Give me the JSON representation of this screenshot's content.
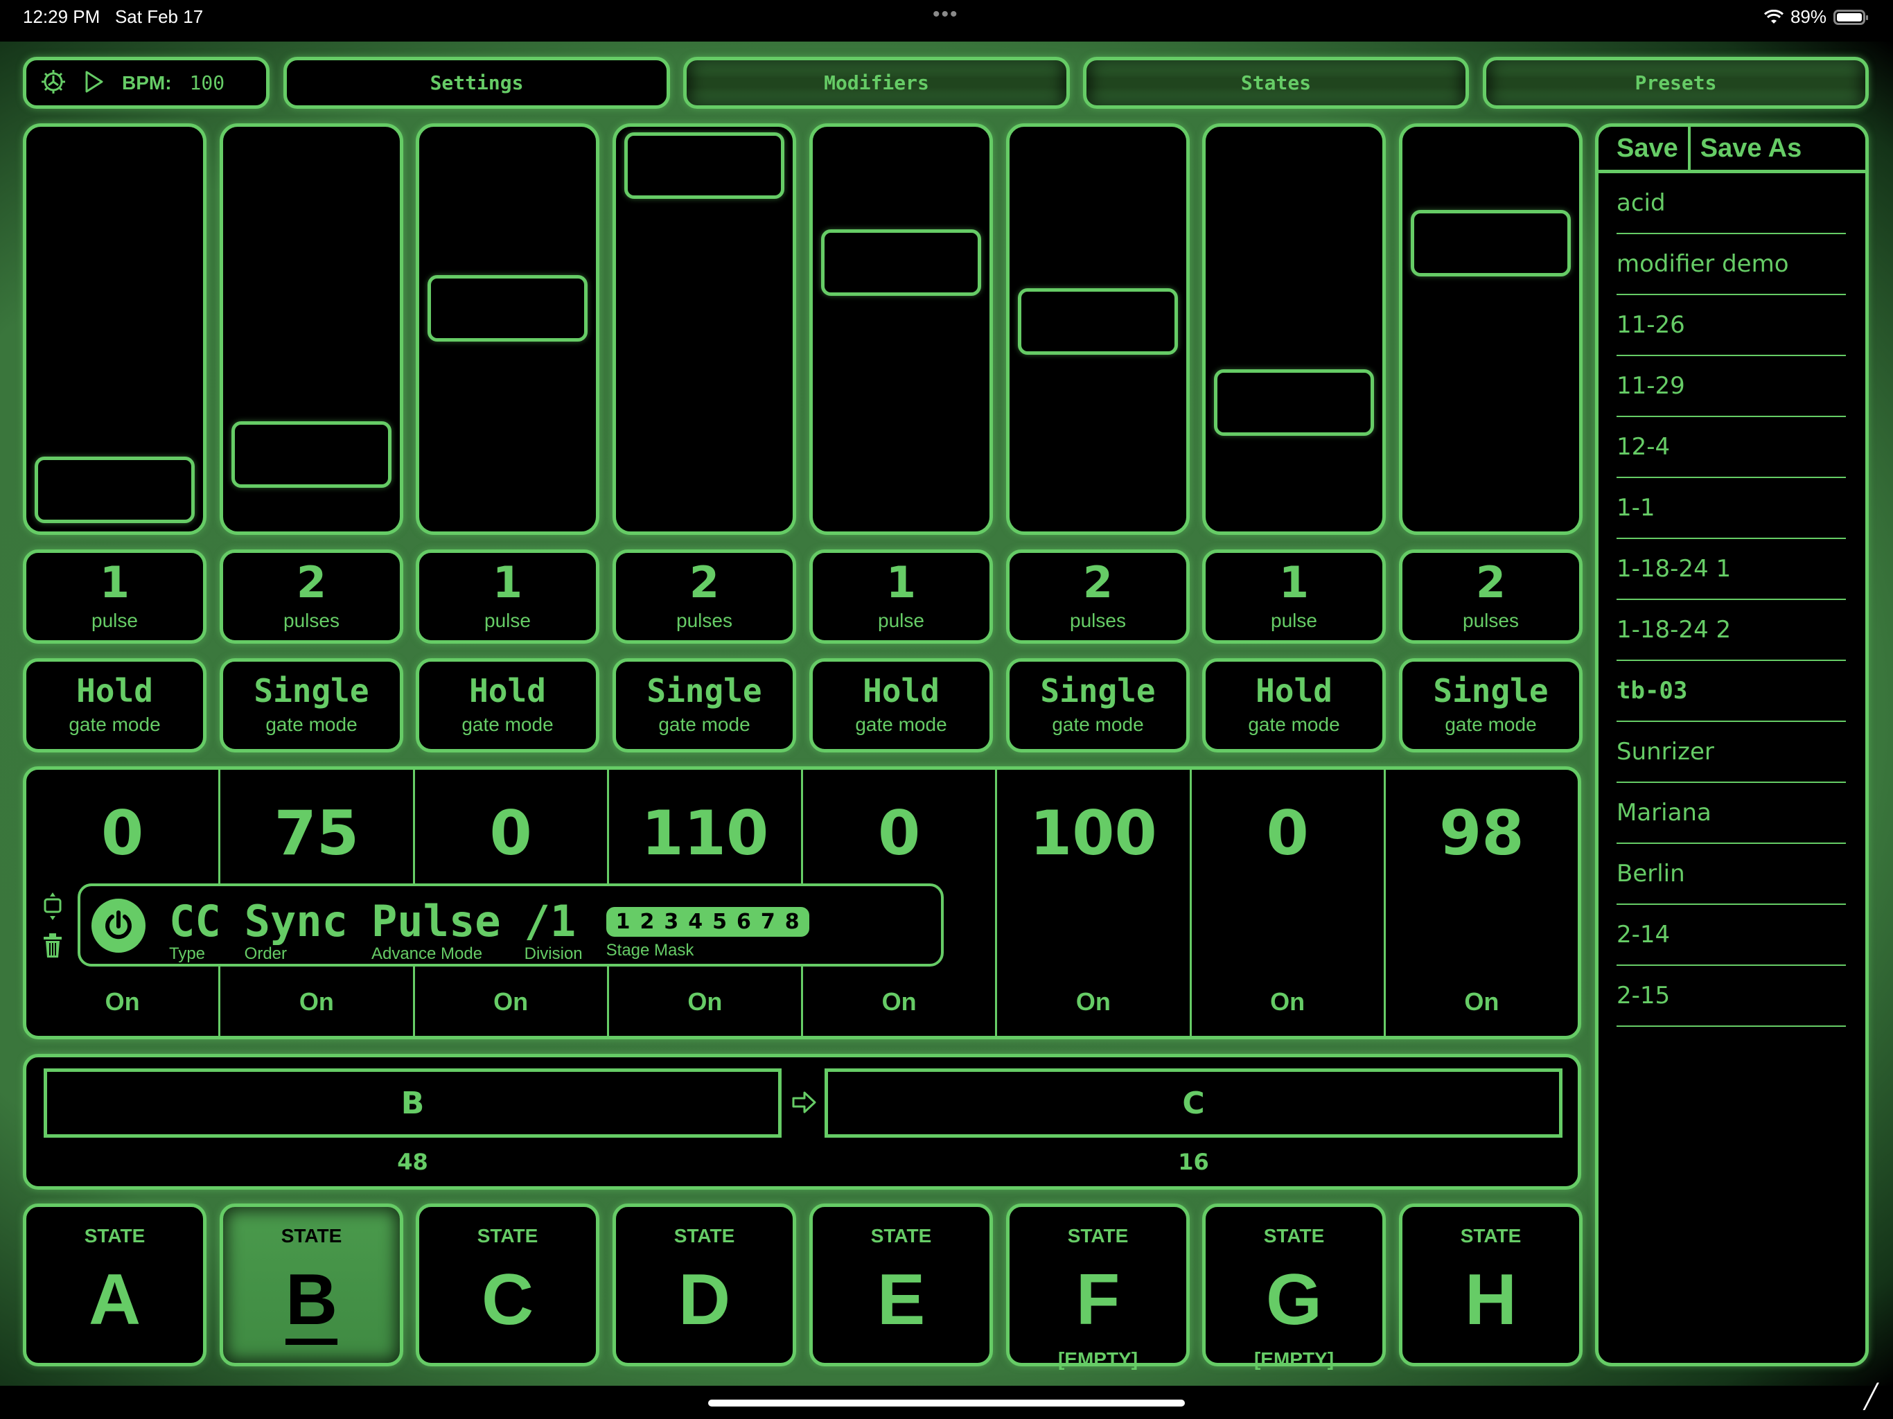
{
  "status_bar": {
    "time": "12:29 PM",
    "date": "Sat Feb 17",
    "battery": "89%",
    "wifi_icon": "wifi-icon",
    "battery_icon": "battery-icon"
  },
  "topbar": {
    "bpm_label": "BPM:",
    "bpm_value": "100",
    "tabs": [
      {
        "label": "Settings",
        "highlighted": false
      },
      {
        "label": "Modifiers",
        "highlighted": true
      },
      {
        "label": "States",
        "highlighted": true
      },
      {
        "label": "Presets",
        "highlighted": true
      }
    ]
  },
  "stages": [
    {
      "slider": 0.0,
      "pulses": "1",
      "pulse_unit": "pulse",
      "gate": "Hold",
      "gate_label": "gate mode",
      "value": "0",
      "status": "On"
    },
    {
      "slider": 0.11,
      "pulses": "2",
      "pulse_unit": "pulses",
      "gate": "Single",
      "gate_label": "gate mode",
      "value": "75",
      "status": "On"
    },
    {
      "slider": 0.56,
      "pulses": "1",
      "pulse_unit": "pulse",
      "gate": "Hold",
      "gate_label": "gate mode",
      "value": "0",
      "status": "On"
    },
    {
      "slider": 1.0,
      "pulses": "2",
      "pulse_unit": "pulses",
      "gate": "Single",
      "gate_label": "gate mode",
      "value": "110",
      "status": "On"
    },
    {
      "slider": 0.7,
      "pulses": "1",
      "pulse_unit": "pulse",
      "gate": "Hold",
      "gate_label": "gate mode",
      "value": "0",
      "status": "On"
    },
    {
      "slider": 0.52,
      "pulses": "2",
      "pulse_unit": "pulses",
      "gate": "Single",
      "gate_label": "gate mode",
      "value": "100",
      "status": "On"
    },
    {
      "slider": 0.27,
      "pulses": "1",
      "pulse_unit": "pulse",
      "gate": "Hold",
      "gate_label": "gate mode",
      "value": "0",
      "status": "On"
    },
    {
      "slider": 0.76,
      "pulses": "2",
      "pulse_unit": "pulses",
      "gate": "Single",
      "gate_label": "gate mode",
      "value": "98",
      "status": "On"
    }
  ],
  "modifier": {
    "type": {
      "value": "CC",
      "label": "Type"
    },
    "order": {
      "value": "Sync",
      "label": "Order"
    },
    "advance": {
      "value": "Pulse",
      "label": "Advance Mode"
    },
    "division": {
      "value": "/1",
      "label": "Division"
    },
    "stage_mask": {
      "values": [
        "1",
        "2",
        "3",
        "4",
        "5",
        "6",
        "7",
        "8"
      ],
      "label": "Stage Mask"
    }
  },
  "sequence": {
    "from": {
      "state": "B",
      "count": "48"
    },
    "to": {
      "state": "C",
      "count": "16"
    }
  },
  "states": [
    {
      "label": "STATE",
      "letter": "A",
      "note": "",
      "selected": false
    },
    {
      "label": "STATE",
      "letter": "B",
      "note": "",
      "selected": true
    },
    {
      "label": "STATE",
      "letter": "C",
      "note": "",
      "selected": false
    },
    {
      "label": "STATE",
      "letter": "D",
      "note": "",
      "selected": false
    },
    {
      "label": "STATE",
      "letter": "E",
      "note": "",
      "selected": false
    },
    {
      "label": "STATE",
      "letter": "F",
      "note": "[EMPTY]",
      "selected": false
    },
    {
      "label": "STATE",
      "letter": "G",
      "note": "[EMPTY]",
      "selected": false
    },
    {
      "label": "STATE",
      "letter": "H",
      "note": "",
      "selected": false
    }
  ],
  "presets": {
    "save_label": "Save",
    "save_as_label": "Save As",
    "items": [
      {
        "name": "acid",
        "active": false
      },
      {
        "name": "modifier demo",
        "active": false
      },
      {
        "name": "11-26",
        "active": false
      },
      {
        "name": "11-29",
        "active": false
      },
      {
        "name": "12-4",
        "active": false
      },
      {
        "name": "1-1",
        "active": false
      },
      {
        "name": "1-18-24 1",
        "active": false
      },
      {
        "name": "1-18-24 2",
        "active": false
      },
      {
        "name": "tb-03",
        "active": true
      },
      {
        "name": "Sunrizer",
        "active": false
      },
      {
        "name": "Mariana",
        "active": false
      },
      {
        "name": "Berlin",
        "active": false
      },
      {
        "name": "2-14",
        "active": false
      },
      {
        "name": "2-15",
        "active": false
      }
    ]
  },
  "colors": {
    "accent": "#66cc66",
    "background": "#000000",
    "glow": "#3d7a3f"
  }
}
